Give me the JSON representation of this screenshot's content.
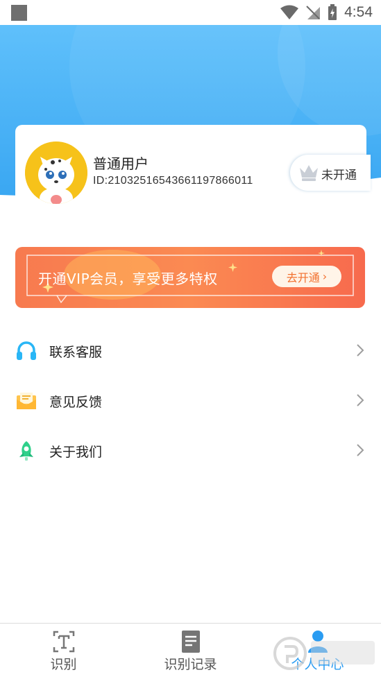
{
  "status_bar": {
    "time": "4:54"
  },
  "profile": {
    "name": "普通用户",
    "user_id": "ID:21032516543661197866011",
    "vip_status": "未开通"
  },
  "vip_banner": {
    "text": "开通VIP会员，享受更多特权",
    "button_label": "去开通",
    "button_chevron": "›"
  },
  "menu": {
    "items": [
      {
        "label": "联系客服",
        "icon": "headset-icon"
      },
      {
        "label": "意见反馈",
        "icon": "envelope-icon"
      },
      {
        "label": "关于我们",
        "icon": "rocket-icon"
      }
    ]
  },
  "bottom_nav": {
    "tabs": [
      {
        "label": "识别",
        "icon": "text-recognize-icon",
        "active": false
      },
      {
        "label": "识别记录",
        "icon": "document-icon",
        "active": false
      },
      {
        "label": "个人中心",
        "icon": "person-icon",
        "active": true
      }
    ]
  },
  "colors": {
    "header_blue": "#4fb3f6",
    "accent_blue": "#2a9cf2",
    "banner_orange": "#f77a4f",
    "banner_button_text": "#f2702e"
  }
}
